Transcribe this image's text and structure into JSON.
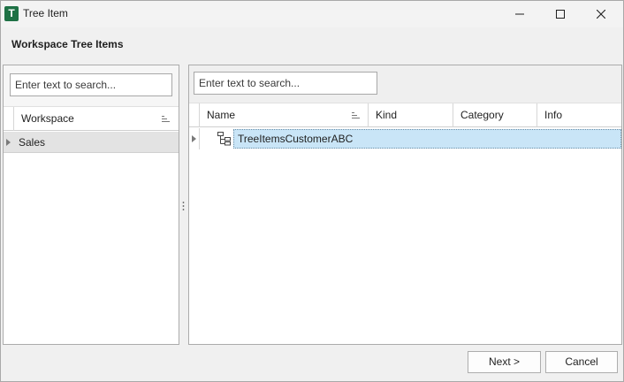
{
  "window": {
    "title": "Tree Item",
    "icon_letter": "T",
    "icon_color": "#1e7145"
  },
  "heading": "Workspace Tree Items",
  "left_panel": {
    "search_placeholder": "Enter text to search...",
    "column_header": "Workspace",
    "rows": [
      {
        "label": "Sales"
      }
    ]
  },
  "right_panel": {
    "search_placeholder": "Enter text to search...",
    "columns": [
      "Name",
      "Kind",
      "Category",
      "Info"
    ],
    "rows": [
      {
        "name": "TreeItemsCustomerABC",
        "kind": "",
        "category": "",
        "info": "",
        "icon": "tree-structure-icon"
      }
    ],
    "selection_color": "#c9e5f7"
  },
  "footer": {
    "next_label": "Next >",
    "cancel_label": "Cancel"
  }
}
